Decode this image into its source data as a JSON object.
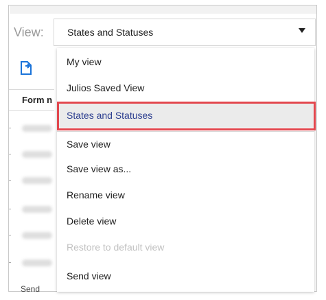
{
  "view": {
    "label": "View:",
    "selected_value": "States and Statuses"
  },
  "table": {
    "column_header": "Form n",
    "bottom_text": "Send"
  },
  "menu": {
    "items": [
      {
        "label": "My view",
        "state": "normal"
      },
      {
        "label": "Julios Saved View",
        "state": "normal"
      },
      {
        "label": "States and Statuses",
        "state": "selected"
      },
      {
        "label": "Save view",
        "state": "normal"
      },
      {
        "label": "Save view as...",
        "state": "normal"
      },
      {
        "label": "Rename view",
        "state": "normal"
      },
      {
        "label": "Delete view",
        "state": "normal"
      },
      {
        "label": "Restore to default view",
        "state": "disabled"
      },
      {
        "label": "Send view",
        "state": "normal"
      }
    ]
  },
  "colors": {
    "highlight_border": "#e2474e",
    "selected_text": "#2b3d8f",
    "selected_bg": "#ebebeb"
  }
}
